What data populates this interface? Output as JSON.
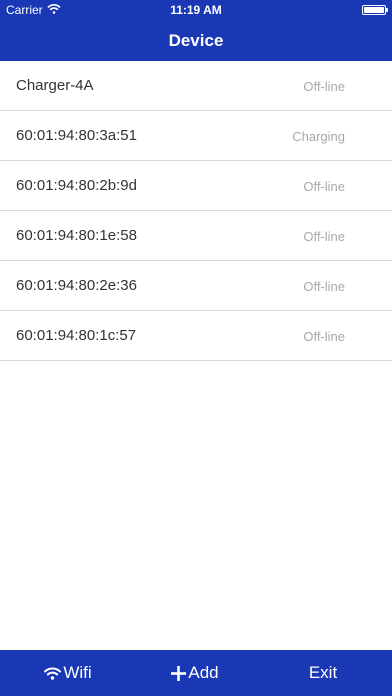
{
  "status_bar": {
    "carrier": "Carrier",
    "time": "11:19 AM"
  },
  "header": {
    "title": "Device"
  },
  "devices": [
    {
      "name": "Charger-4A",
      "status": "Off-line"
    },
    {
      "name": "60:01:94:80:3a:51",
      "status": "Charging"
    },
    {
      "name": "60:01:94:80:2b:9d",
      "status": "Off-line"
    },
    {
      "name": "60:01:94:80:1e:58",
      "status": "Off-line"
    },
    {
      "name": "60:01:94:80:2e:36",
      "status": "Off-line"
    },
    {
      "name": "60:01:94:80:1c:57",
      "status": "Off-line"
    }
  ],
  "toolbar": {
    "wifi_label": "Wifi",
    "add_label": "Add",
    "exit_label": "Exit"
  },
  "colors": {
    "primary": "#1a38b4",
    "status_text": "#a8a8a8",
    "divider": "#d9d9d9"
  },
  "icons": {
    "wifi": "wifi-icon",
    "add": "plus-icon",
    "battery": "battery-icon"
  }
}
